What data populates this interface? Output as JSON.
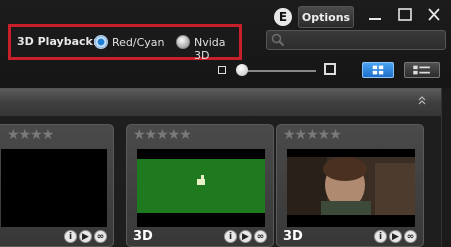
{
  "window": {
    "profile_badge": "E",
    "options_label": "Options"
  },
  "playback": {
    "label": "3D Playback:",
    "options": [
      "Red/Cyan",
      "Nvida 3D"
    ],
    "selected": "Red/Cyan"
  },
  "search": {
    "placeholder": ""
  },
  "cards": [
    {
      "stars": "★★★★",
      "badge": ""
    },
    {
      "stars": "★★★★★",
      "badge": "3D"
    },
    {
      "stars": "★★★★★",
      "badge": "3D"
    }
  ],
  "colors": {
    "accent": "#1f6fc8",
    "highlight_border": "#c8202a"
  }
}
